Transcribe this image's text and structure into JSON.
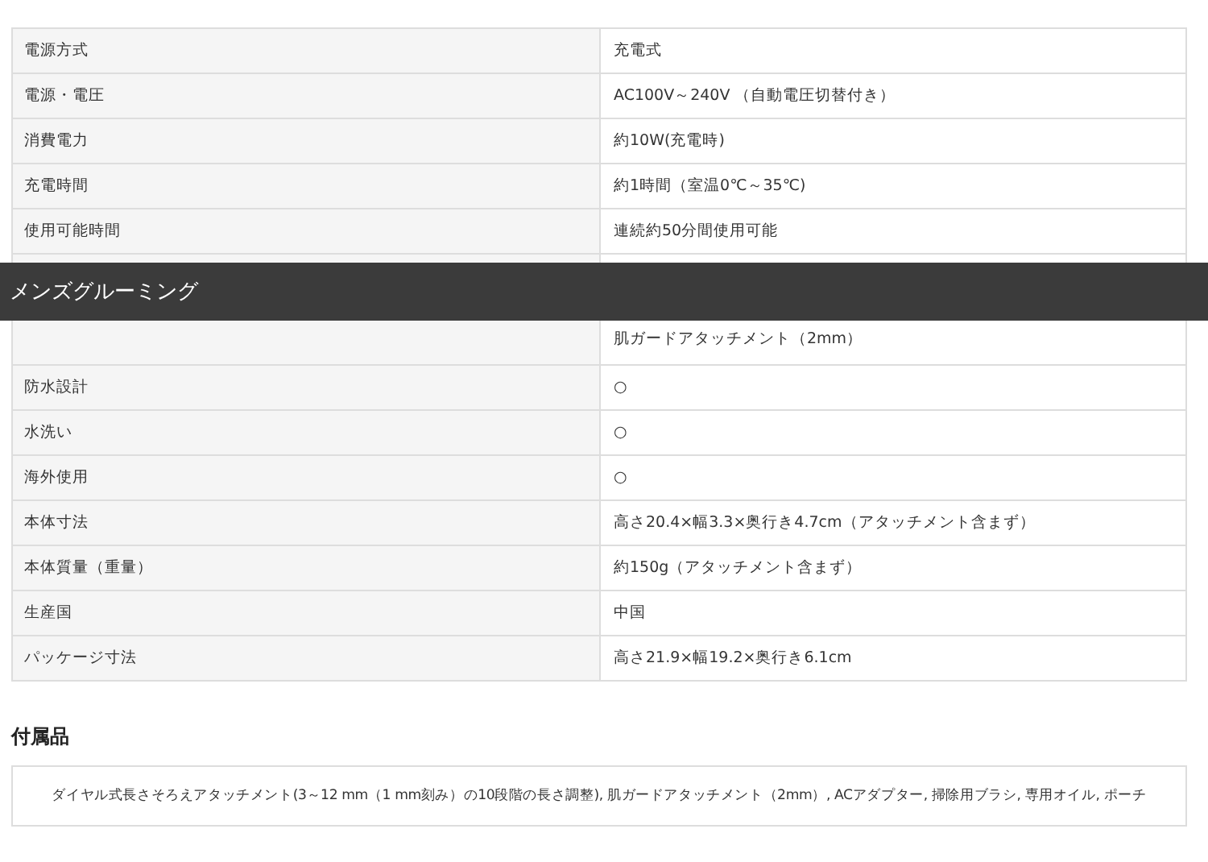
{
  "spec_rows": [
    {
      "label": "電源方式",
      "value": "充電式"
    },
    {
      "label": "電源・電圧",
      "value": "AC100V～240V （自動電圧切替付き）"
    },
    {
      "label": "消費電力",
      "value": "約10W(充電時)"
    },
    {
      "label": "充電時間",
      "value": "約1時間（室温0℃～35℃)"
    },
    {
      "label": "使用可能時間",
      "value": "連続約50分間使用可能"
    },
    {
      "kind": "covered"
    },
    {
      "kind": "covered",
      "value": "肌ガードアタッチメント（2mm）"
    },
    {
      "label": "防水設計",
      "value": "○"
    },
    {
      "label": "水洗い",
      "value": "○"
    },
    {
      "label": "海外使用",
      "value": "○"
    },
    {
      "label": "本体寸法",
      "value": "高さ20.4×幅3.3×奥行き4.7cm（アタッチメント含まず）"
    },
    {
      "label": "本体質量（重量）",
      "value": "約150g（アタッチメント含まず）"
    },
    {
      "label": "生産国",
      "value": "中国"
    },
    {
      "label": "パッケージ寸法",
      "value": "高さ21.9×幅19.2×奥行き6.1cm"
    }
  ],
  "overlay_bar": {
    "title": "メンズグルーミング"
  },
  "accessories": {
    "heading": "付属品",
    "text": "ダイヤル式長さそろえアタッチメント(3～12 mm（1 mm刻み）の10段階の長さ調整), 肌ガードアタッチメント（2mm）, ACアダプター, 掃除用ブラシ, 専用オイル, ポーチ"
  }
}
